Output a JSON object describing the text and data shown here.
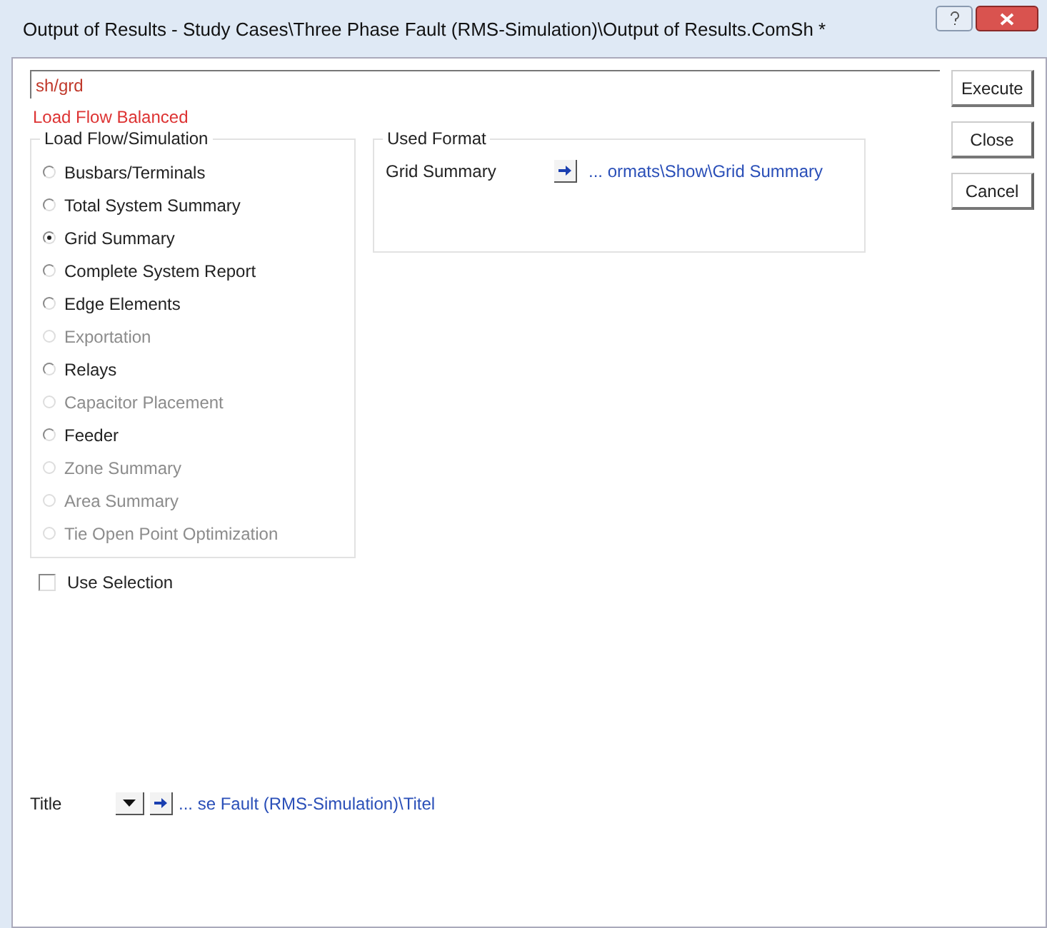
{
  "window": {
    "title": "Output of Results - Study Cases\\Three Phase Fault (RMS-Simulation)\\Output of Results.ComSh *"
  },
  "command": {
    "value": "sh/grd"
  },
  "status": "Load Flow Balanced",
  "options": {
    "title": "Load Flow/Simulation",
    "items": [
      {
        "label": "Busbars/Terminals",
        "selected": false,
        "disabled": false
      },
      {
        "label": "Total System Summary",
        "selected": false,
        "disabled": false
      },
      {
        "label": "Grid Summary",
        "selected": true,
        "disabled": false
      },
      {
        "label": "Complete System Report",
        "selected": false,
        "disabled": false
      },
      {
        "label": "Edge Elements",
        "selected": false,
        "disabled": false
      },
      {
        "label": "Exportation",
        "selected": false,
        "disabled": true
      },
      {
        "label": "Relays",
        "selected": false,
        "disabled": false
      },
      {
        "label": "Capacitor Placement",
        "selected": false,
        "disabled": true
      },
      {
        "label": "Feeder",
        "selected": false,
        "disabled": false
      },
      {
        "label": "Zone Summary",
        "selected": false,
        "disabled": true
      },
      {
        "label": "Area Summary",
        "selected": false,
        "disabled": true
      },
      {
        "label": "Tie Open Point Optimization",
        "selected": false,
        "disabled": true
      }
    ]
  },
  "used_format": {
    "title": "Used Format",
    "label": "Grid Summary",
    "path": "... ormats\\Show\\Grid Summary"
  },
  "use_selection": {
    "label": "Use Selection",
    "checked": false
  },
  "title_row": {
    "label": "Title",
    "path": "... se Fault (RMS-Simulation)\\Titel"
  },
  "buttons": [
    "Execute",
    "Close",
    "Cancel"
  ]
}
